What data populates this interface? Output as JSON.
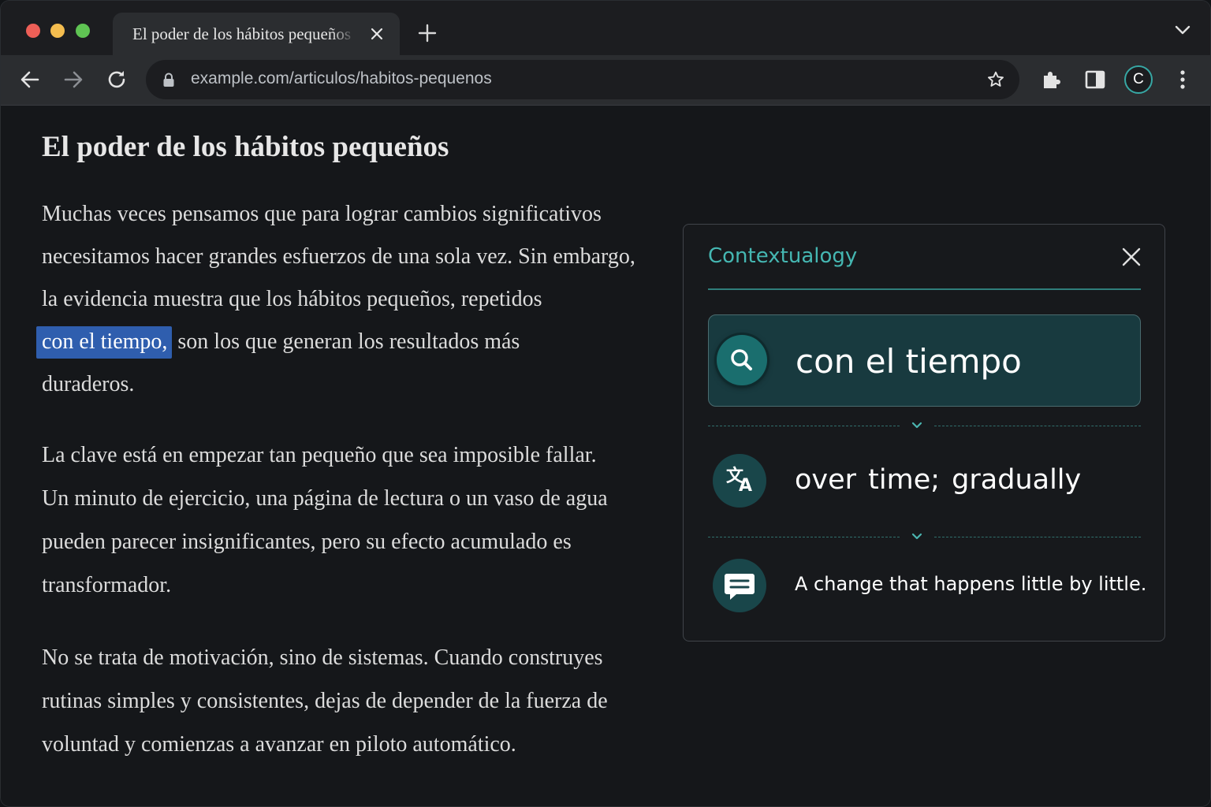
{
  "browser": {
    "tab": {
      "title": "El poder de los hábitos pequeños"
    },
    "address_bar": {
      "url": "example.com/articulos/habitos-pequenos"
    },
    "profile_initial": "C",
    "icons": {
      "tab_close": "close-icon",
      "new_tab": "plus-icon",
      "tab_list": "chevron-down-icon",
      "back": "arrow-left-icon",
      "forward": "arrow-right-icon",
      "reload": "reload-icon",
      "lock": "lock-icon",
      "bookmark": "star-icon",
      "extensions": "puzzle-icon",
      "side_panel": "side-panel-icon",
      "menu": "kebab-menu-icon"
    }
  },
  "article": {
    "title": "El poder de los hábitos pequeños",
    "p1": {
      "line1": "Muchas veces pensamos que para lograr cambios significativos",
      "line2": "necesitamos hacer grandes esfuerzos de una sola vez. Sin embargo,",
      "line3": "la evidencia muestra que los hábitos pequeños, repetidos",
      "selected": "con el tiempo,",
      "line4_rest": " son los que generan los resultados más",
      "line5": "duraderos."
    },
    "p2": {
      "line1": "La clave está en empezar tan pequeño que sea imposible fallar.",
      "line2": "Un minuto de ejercicio, una página de lectura o un vaso de agua",
      "line3": "pueden parecer insignificantes, pero su efecto acumulado es",
      "line4": "transformador."
    },
    "p3": {
      "line1": "No se trata de motivación, sino de sistemas. Cuando construyes",
      "line2": "rutinas simples y consistentes, dejas de depender de la fuerza de",
      "line3": "voluntad y comienzas a avanzar en piloto automático."
    }
  },
  "popup": {
    "title": "Contextualogy",
    "term": "con el tiempo",
    "translation": "over time; gradually",
    "definition": "A change that happens little by little.",
    "icons": {
      "close": "close-icon",
      "term": "search-icon",
      "translation": "translate-icon",
      "definition": "chat-bubble-icon",
      "divider": "chevron-down-icon"
    }
  },
  "colors": {
    "accent_teal": "#45b7b2",
    "selection_blue": "#2f5eae",
    "term_card_bg": "#183a3f",
    "window_bg": "#15171a"
  }
}
